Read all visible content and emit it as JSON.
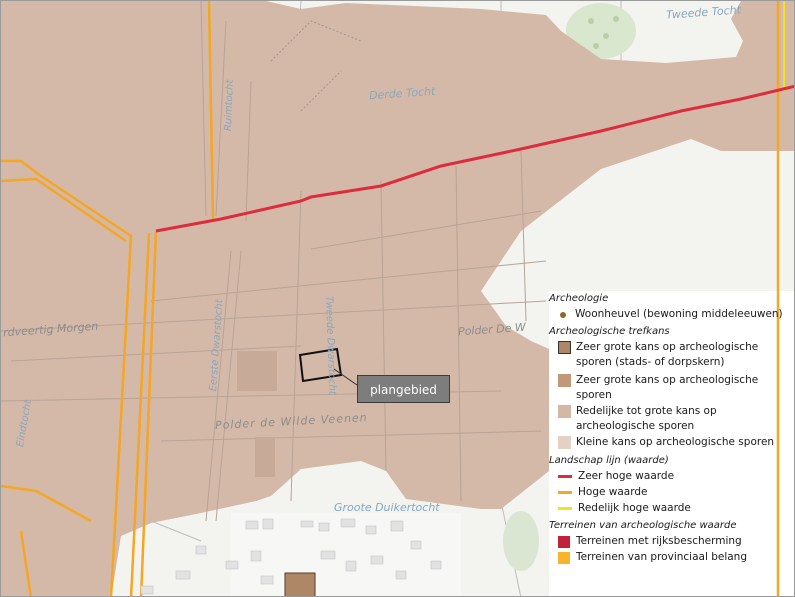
{
  "map": {
    "place_labels": {
      "tweede_tocht": "Tweede Tocht",
      "derde_tocht": "Derde Tocht",
      "tweede_dwarstocht": "Tweede Dwarstocht",
      "eerste_dwarstocht": "Eerste Dwarstocht",
      "polder_de_w": "Polder De W",
      "polder_de_wilde_veenen": "Polder de Wilde Veenen",
      "vierdveertig_morgen": "rdveertig Morgen",
      "groote_duikertocht": "Groote Duikertocht",
      "eindtocht": "Eindtocht",
      "ruimtocht": "Ruimtocht"
    },
    "plan_area_label": "plangebied"
  },
  "legend": {
    "archeologie": {
      "title": "Archeologie",
      "items": [
        {
          "label": "Woonheuvel (bewoning middeleeuwen)",
          "color": "#8b6a2c"
        }
      ]
    },
    "trefkans": {
      "title": "Archeologische trefkans",
      "items": [
        {
          "label1": "Zeer grote kans op archeologische",
          "label2": "sporen (stads- of dorpskern)",
          "color": "#ae8766"
        },
        {
          "label1": "Zeer grote kans op archeologische",
          "label2": "sporen",
          "color": "#c19978"
        },
        {
          "label1": "Redelijke tot grote kans op",
          "label2": "archeologische sporen",
          "color": "#d4b8a5"
        },
        {
          "label1": "Kleine kans op archeologische sporen",
          "label2": "",
          "color": "#e5d1c3"
        }
      ]
    },
    "landschap": {
      "title": "Landschap lijn (waarde)",
      "items": [
        {
          "label": "Zeer hoge waarde",
          "color": "#dc2c3d"
        },
        {
          "label": "Hoge waarde",
          "color": "#f5a623"
        },
        {
          "label": "Redelijk hoge waarde",
          "color": "#f2e31b"
        }
      ]
    },
    "terreinen": {
      "title": "Terreinen van archeologische waarde",
      "items": [
        {
          "label": "Terreinen met rijksbescherming",
          "color": "#c0223a"
        },
        {
          "label": "Terreinen van provinciaal belang",
          "color": "#f7b52b"
        }
      ]
    }
  },
  "colors": {
    "zone_fill": "#d4b9a8",
    "background": "#f1f1ef",
    "ditch": "#b3b3b3",
    "water_label": "#7fa9c9"
  }
}
